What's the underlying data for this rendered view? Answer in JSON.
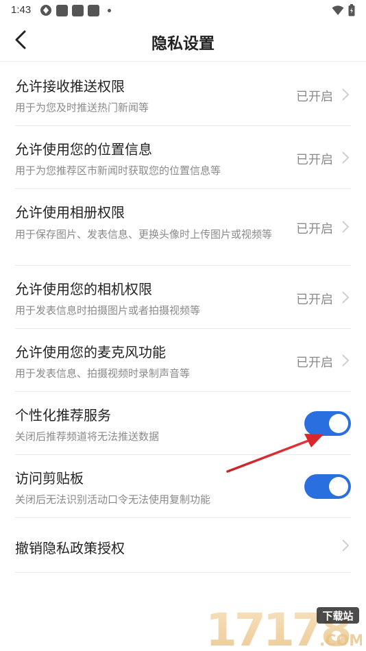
{
  "status_bar": {
    "time": "1:43"
  },
  "header": {
    "title": "隐私设置"
  },
  "items": [
    {
      "title": "允许接收推送权限",
      "desc": "用于为您及时推送热门新闻等",
      "status": "已开启"
    },
    {
      "title": "允许使用您的位置信息",
      "desc": "用于为您推荐区市新闻时获取您的位置信息等",
      "status": "已开启"
    },
    {
      "title": "允许使用相册权限",
      "desc": "用于保存图片、发表信息、更换头像时上传图片或视频等",
      "status": "已开启"
    },
    {
      "title": "允许使用您的相机权限",
      "desc": "用于发表信息时拍摄图片或者拍摄视频等",
      "status": "已开启"
    },
    {
      "title": "允许使用您的麦克风功能",
      "desc": "用于发表信息、拍摄视频时录制声音等",
      "status": "已开启"
    }
  ],
  "toggles": [
    {
      "title": "个性化推荐服务",
      "desc": "关闭后推荐频道将无法推送数据",
      "on": true
    },
    {
      "title": "访问剪贴板",
      "desc": "关闭后无法识别活动口令无法使用复制功能",
      "on": true
    }
  ],
  "revoke": {
    "title": "撤销隐私政策授权"
  },
  "watermark": {
    "main": "17178",
    "tag": "下载站",
    "domain": ".COM"
  },
  "colors": {
    "accent": "#2a6fe0",
    "arrow": "#d9262b"
  }
}
